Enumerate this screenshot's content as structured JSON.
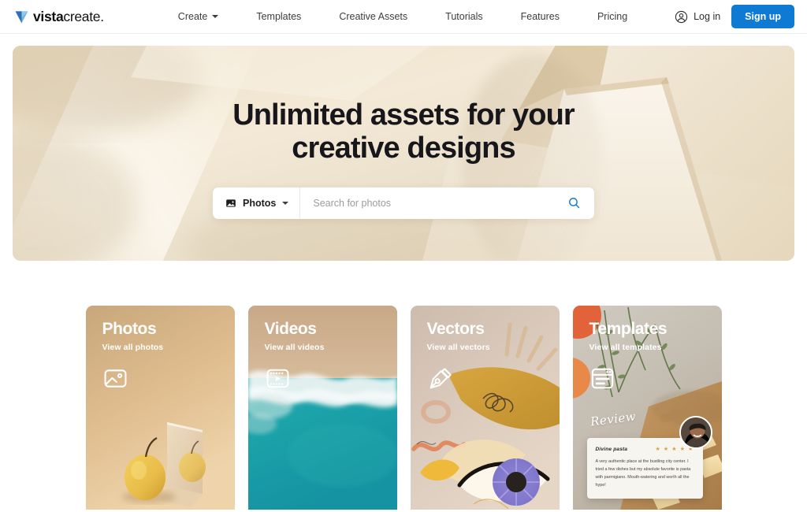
{
  "brand": {
    "name_bold": "vista",
    "name_light": "create.",
    "logo_icon": "vistacreate-v-logo-icon",
    "accent_blue": "#0f7ad4",
    "logo_blue_dark": "#2f6fb5",
    "logo_blue_light": "#6fb6e0"
  },
  "header": {
    "nav": [
      {
        "label": "Create",
        "has_dropdown": true
      },
      {
        "label": "Templates",
        "has_dropdown": false
      },
      {
        "label": "Creative Assets",
        "has_dropdown": false
      },
      {
        "label": "Tutorials",
        "has_dropdown": false
      },
      {
        "label": "Features",
        "has_dropdown": false
      },
      {
        "label": "Pricing",
        "has_dropdown": false
      }
    ],
    "login_label": "Log in",
    "login_icon": "user-avatar-icon",
    "signup_label": "Sign up"
  },
  "hero": {
    "title_line1": "Unlimited assets for your",
    "title_line2": "creative designs",
    "search": {
      "type_label": "Photos",
      "type_icon": "image-icon",
      "dropdown_icon": "chevron-down-icon",
      "placeholder": "Search for photos",
      "value": "",
      "submit_icon": "search-icon"
    }
  },
  "cards": [
    {
      "title": "Photos",
      "subtitle": "View all photos",
      "icon": "image-icon",
      "bg_color": "#c9a97f"
    },
    {
      "title": "Videos",
      "subtitle": "View all videos",
      "icon": "video-film-play-icon",
      "bg_color": "#1f9aa0"
    },
    {
      "title": "Vectors",
      "subtitle": "View all vectors",
      "icon": "pen-nib-icon",
      "bg_color": "#cbbdb2"
    },
    {
      "title": "Templates",
      "subtitle": "View all templates",
      "icon": "template-window-icon",
      "bg_color": "#bdb5a8"
    }
  ],
  "template_preview": {
    "script_label": "Review",
    "review_title": "Divine pasta",
    "stars": "★ ★ ★ ★ ★",
    "review_text": "A very authentic place at the bustling city center. I tried a few dishes but my absolute favorite is pasta with parmigiano. Mouth-watering and worth all the hype!",
    "avatar_icon": "person-avatar-photo"
  }
}
